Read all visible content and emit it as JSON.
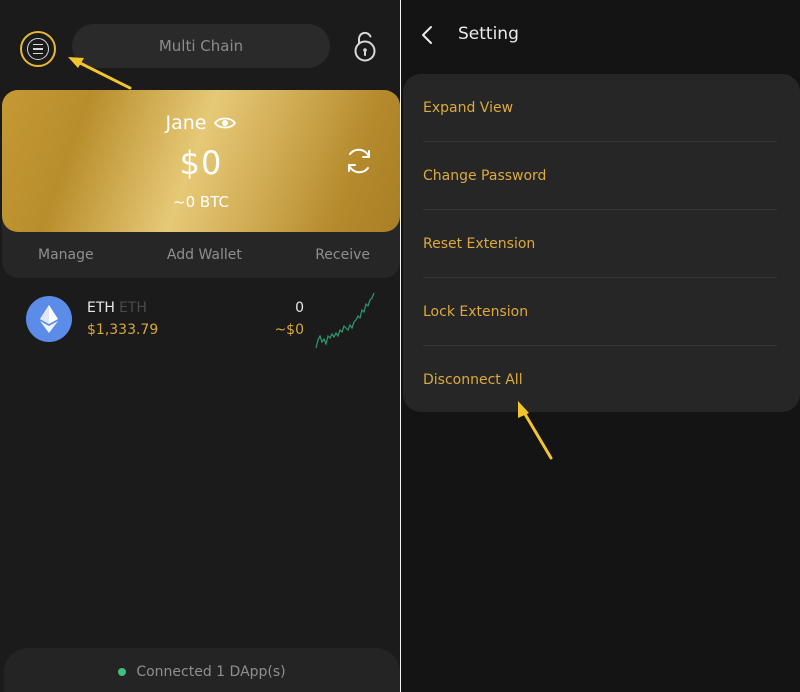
{
  "wallet": {
    "chain_selector": "Multi Chain",
    "account_name": "Jane",
    "balance": "$0",
    "balance_btc": "~0 BTC",
    "actions": [
      "Manage",
      "Add Wallet",
      "Receive"
    ]
  },
  "tokens": [
    {
      "symbol": "ETH",
      "sub_symbol": "ETH",
      "price": "$1,333.79",
      "amount": "0",
      "value": "~$0",
      "icon": "ethereum-icon"
    }
  ],
  "footer": {
    "status": "Connected 1 DApp(s)",
    "status_color": "#3fbf7f"
  },
  "settings": {
    "title": "Setting",
    "items": [
      "Expand View",
      "Change Password",
      "Reset Extension",
      "Lock Extension",
      "Disconnect All"
    ]
  },
  "colors": {
    "accent_gold": "#dcaa3e",
    "annotation_arrow": "#f2c52e"
  }
}
